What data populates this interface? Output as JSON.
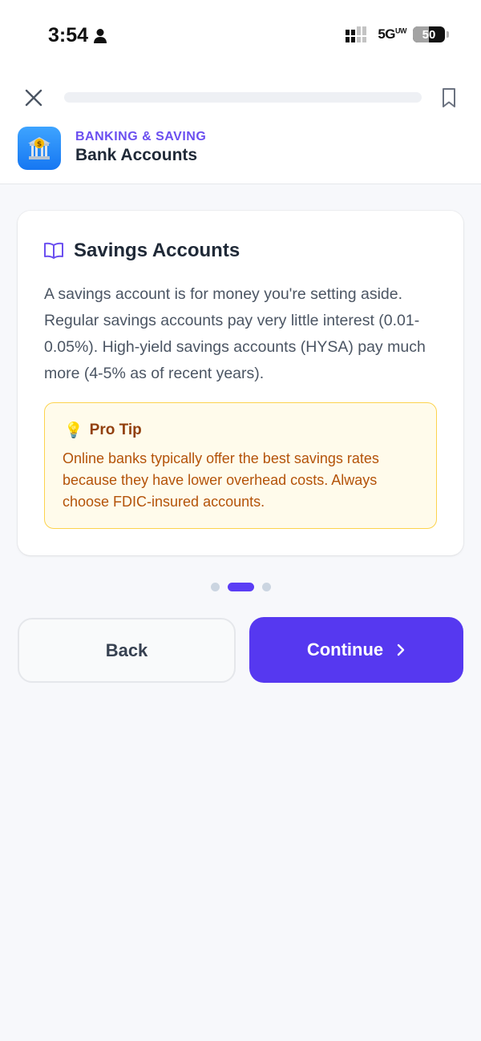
{
  "status_bar": {
    "time": "3:54",
    "network": "5G",
    "network_suffix": "UW",
    "battery": "50",
    "battery_level": 0.5
  },
  "header": {
    "progress": 0,
    "category": "BANKING & SAVING",
    "title": "Bank Accounts",
    "lesson_icon": "bank-icon"
  },
  "card": {
    "icon": "book-open-icon",
    "title": "Savings Accounts",
    "body": "A savings account is for money you're setting aside. Regular savings accounts pay very little interest (0.01-0.05%). High-yield savings accounts (HYSA) pay much more (4-5% as of recent years).",
    "tip": {
      "icon": "lightbulb-icon",
      "emoji": "💡",
      "title": "Pro Tip",
      "body": "Online banks typically offer the best savings rates because they have lower overhead costs. Always choose FDIC-insured accounts."
    }
  },
  "pagination": {
    "total": 3,
    "current": 2
  },
  "actions": {
    "back_label": "Back",
    "continue_label": "Continue"
  },
  "colors": {
    "accent": "#5638f0",
    "category": "#6b4ff0",
    "tip_background": "#fffbeb",
    "tip_border": "#fcd34d",
    "tip_title": "#92400e",
    "tip_text": "#b45309"
  }
}
